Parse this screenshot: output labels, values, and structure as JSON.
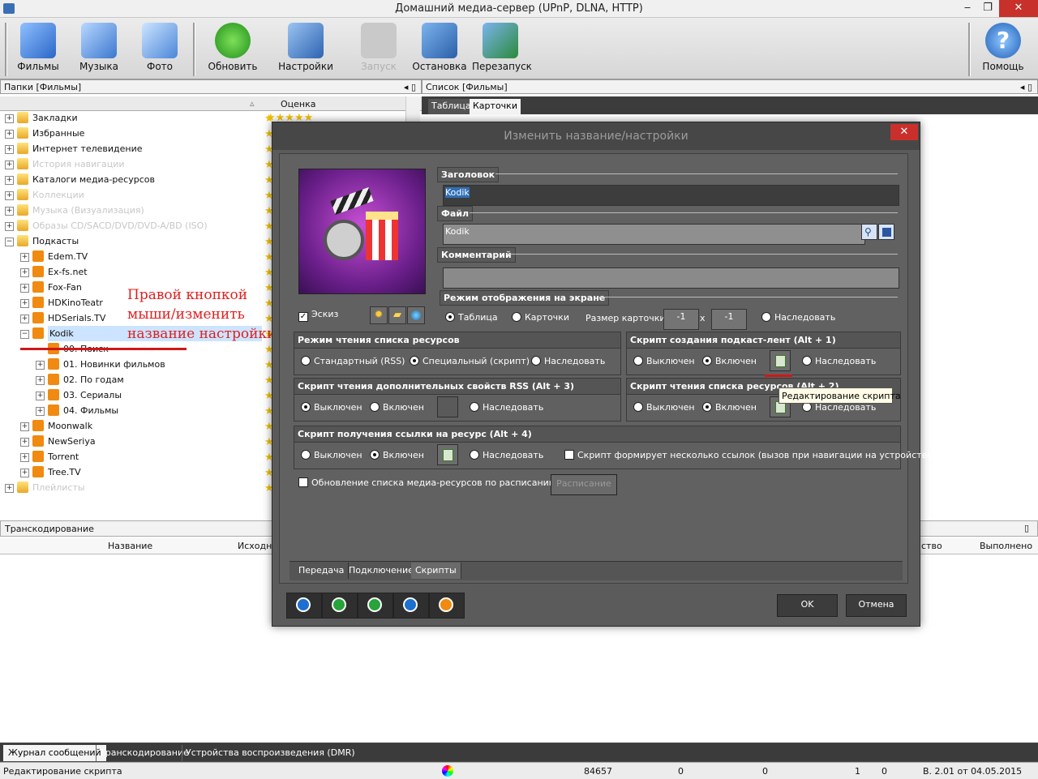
{
  "window": {
    "title": "Домашний медиа-сервер (UPnP, DLNA, HTTP)"
  },
  "toolbar": {
    "buttons": [
      {
        "label": "Фильмы",
        "icon": "film-icon"
      },
      {
        "label": "Музыка",
        "icon": "music-icon"
      },
      {
        "label": "Фото",
        "icon": "photo-icon"
      },
      {
        "label": "Обновить",
        "icon": "refresh-icon"
      },
      {
        "label": "Настройки",
        "icon": "settings-icon"
      },
      {
        "label": "Запуск",
        "icon": "start-icon"
      },
      {
        "label": "Остановка",
        "icon": "stop-icon"
      },
      {
        "label": "Перезапуск",
        "icon": "restart-icon"
      },
      {
        "label": "Помощь",
        "icon": "help-icon"
      }
    ]
  },
  "left_panel": {
    "header": "Папки [Фильмы]",
    "col_rating": "Оценка",
    "tree": [
      {
        "label": "Закладки",
        "level": 0,
        "dim": false
      },
      {
        "label": "Избранные",
        "level": 0,
        "dim": false
      },
      {
        "label": "Интернет телевидение",
        "level": 0,
        "dim": false
      },
      {
        "label": "История навигации",
        "level": 0,
        "dim": true
      },
      {
        "label": "Каталоги медиа-ресурсов",
        "level": 0,
        "dim": false
      },
      {
        "label": "Коллекции",
        "level": 0,
        "dim": true
      },
      {
        "label": "Музыка (Визуализация)",
        "level": 0,
        "dim": true
      },
      {
        "label": "Образы CD/SACD/DVD/DVD-A/BD (ISO)",
        "level": 0,
        "dim": true
      },
      {
        "label": "Подкасты",
        "level": 0,
        "dim": false
      },
      {
        "label": "Edem.TV",
        "level": 1,
        "dim": false
      },
      {
        "label": "Ex-fs.net",
        "level": 1,
        "dim": false
      },
      {
        "label": "Fox-Fan",
        "level": 1,
        "dim": false
      },
      {
        "label": "HDKinoTeatr",
        "level": 1,
        "dim": false
      },
      {
        "label": "HDSerials.TV",
        "level": 1,
        "dim": false
      },
      {
        "label": "Kodik",
        "level": 1,
        "dim": false
      },
      {
        "label": "00. Поиск",
        "level": 2,
        "dim": false
      },
      {
        "label": "01. Новинки фильмов",
        "level": 2,
        "dim": false
      },
      {
        "label": "02. По годам",
        "level": 2,
        "dim": false
      },
      {
        "label": "03. Сериалы",
        "level": 2,
        "dim": false
      },
      {
        "label": "04. Фильмы",
        "level": 2,
        "dim": false
      },
      {
        "label": "Moonwalk",
        "level": 1,
        "dim": false
      },
      {
        "label": "NewSeriya",
        "level": 1,
        "dim": false
      },
      {
        "label": "Torrent",
        "level": 1,
        "dim": false
      },
      {
        "label": "Tree.TV",
        "level": 1,
        "dim": false
      },
      {
        "label": "Плейлисты",
        "level": 0,
        "dim": true
      }
    ],
    "annotation": [
      "Правой кнопкой",
      "мыши/изменить",
      "название настройки"
    ]
  },
  "right_panel": {
    "header": "Список [Фильмы]",
    "tabs": [
      "Таблица",
      "Карточки"
    ]
  },
  "bottom_panel": {
    "header": "Транскодирование",
    "columns": [
      "Название",
      "Исходный",
      "ство",
      "Выполнено"
    ],
    "tabs": [
      "Журнал сообщений",
      "Транскодирование",
      "Устройства воспроизведения (DMR)"
    ]
  },
  "status_bar": {
    "text": "Редактирование скрипта",
    "count": "84657",
    "v1": "0",
    "v2": "0",
    "v3": "1",
    "v4": "0",
    "version": "В. 2.01 от 04.05.2015"
  },
  "dialog": {
    "title": "Изменить название/настройки",
    "close": "✕",
    "title_label": "Заголовок",
    "title_value": "Kodik",
    "file_label": "Файл",
    "file_value": "Kodik",
    "comment_label": "Комментарий",
    "comment_value": "",
    "sketch_label": "Эскиз",
    "display_mode": {
      "header": "Режим отображения на экране",
      "table": "Таблица",
      "cards": "Карточки",
      "card_size": "Размер карточки",
      "w": "-1",
      "x": "x",
      "h": "-1",
      "inherit": "Наследовать"
    },
    "read_mode": {
      "header": "Режим чтения списка ресурсов",
      "opt1": "Стандартный (RSS)",
      "opt2": "Специальный (скрипт)",
      "opt3": "Наследовать"
    },
    "podcast_script": {
      "header": "Скрипт создания подкаст-лент (Alt + 1)",
      "off": "Выключен",
      "on": "Включен",
      "inherit": "Наследовать"
    },
    "rss_script": {
      "header": "Скрипт чтения дополнительных свойств RSS (Alt + 3)",
      "off": "Выключен",
      "on": "Включен",
      "inherit": "Наследовать"
    },
    "list_script": {
      "header": "Скрипт чтения списка ресурсов (Alt + 2)",
      "off": "Выключен",
      "on": "Включен",
      "inherit": "Наследовать"
    },
    "link_script": {
      "header": "Скрипт получения ссылки на ресурс (Alt + 4)",
      "off": "Выключен",
      "on": "Включен",
      "inherit": "Наследовать",
      "multi": "Скрипт формирует несколько ссылок (вызов при навигации на устройстве)"
    },
    "schedule_label": "Обновление списка медиа-ресурсов по расписанию",
    "schedule_button": "Расписание",
    "tabs": [
      "Передача",
      "Подключение",
      "Скрипты"
    ],
    "ok": "OK",
    "cancel": "Отмена",
    "tooltip": "Редактирование скрипта"
  }
}
